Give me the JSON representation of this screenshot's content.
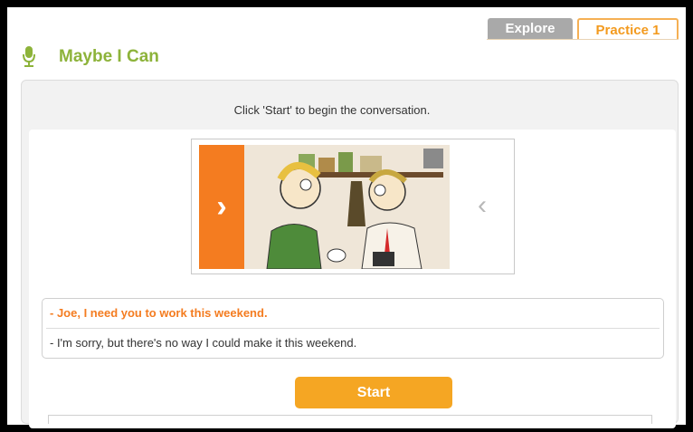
{
  "tabs": {
    "explore": "Explore",
    "practice": "Practice 1"
  },
  "page": {
    "title": "Maybe I Can",
    "icon": "microphone-icon"
  },
  "instruction": "Click 'Start' to begin the conversation.",
  "carousel": {
    "next_icon": "chevron-right-icon",
    "prev_icon": "chevron-left-icon",
    "next_glyph": "›",
    "prev_glyph": "‹",
    "next_color": "#f47c20"
  },
  "dialog": {
    "line1": "- Joe, I need you to work this weekend.",
    "line2": "- I'm sorry, but there's no way I could make it this weekend."
  },
  "start_label": "Start",
  "colors": {
    "brand_green": "#8db33a",
    "accent_orange": "#f47c20",
    "start_button": "#f5a623"
  }
}
